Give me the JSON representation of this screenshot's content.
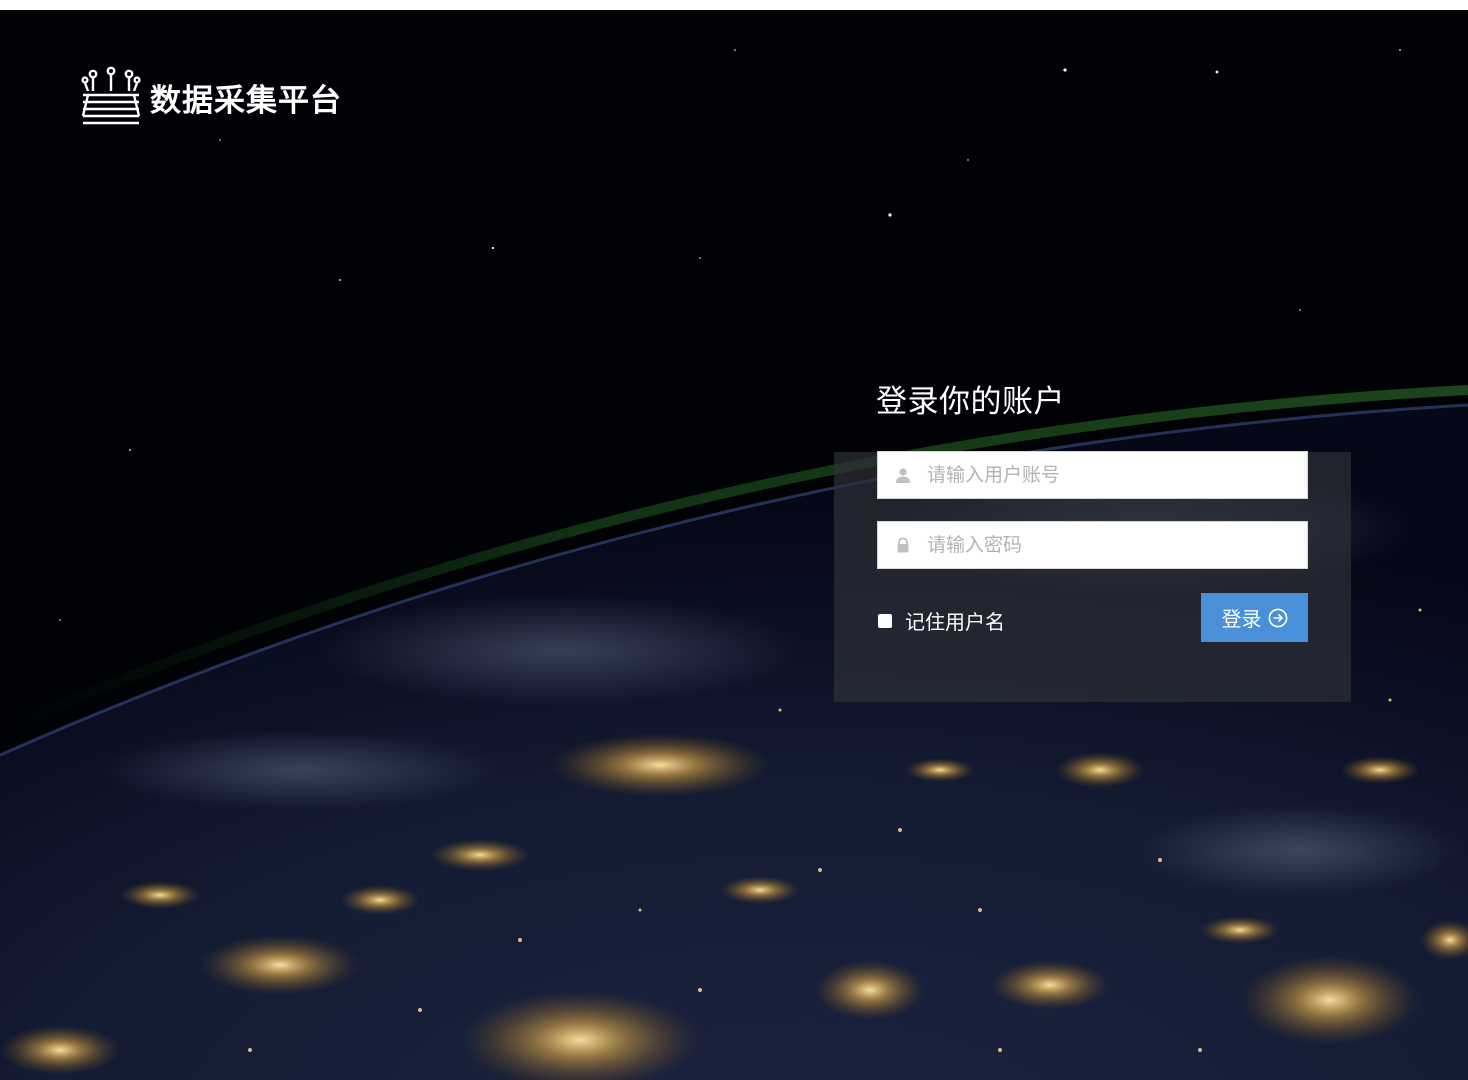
{
  "brand": {
    "title": "数据采集平台",
    "logo_icon": "data-collection-logo-icon"
  },
  "login": {
    "heading": "登录你的账户",
    "username": {
      "placeholder": "请输入用户账号",
      "value": "",
      "icon": "user-icon"
    },
    "password": {
      "placeholder": "请输入密码",
      "value": "",
      "icon": "lock-icon"
    },
    "remember_label": "记住用户名",
    "remember_checked": false,
    "submit_label": "登录",
    "submit_icon": "arrow-right-circle-icon"
  },
  "colors": {
    "accent": "#4a90d9",
    "panel": "#2d3037",
    "background": "#020307"
  }
}
